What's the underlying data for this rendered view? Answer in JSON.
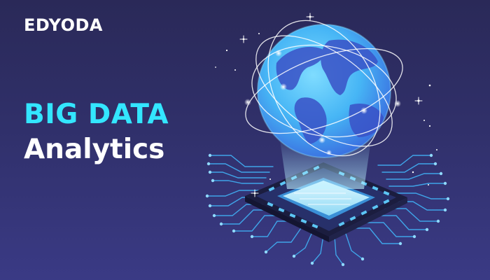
{
  "brand": {
    "name": "EDYODA"
  },
  "headline": {
    "line1": "BIG DATA",
    "line2": "Analytics"
  },
  "colors": {
    "background_top": "#2a2958",
    "background_bottom": "#3a3a85",
    "accent": "#33e6ff",
    "text": "#ffffff"
  },
  "illustration": {
    "globe_icon": "globe-icon",
    "chip_icon": "microchip-icon"
  }
}
